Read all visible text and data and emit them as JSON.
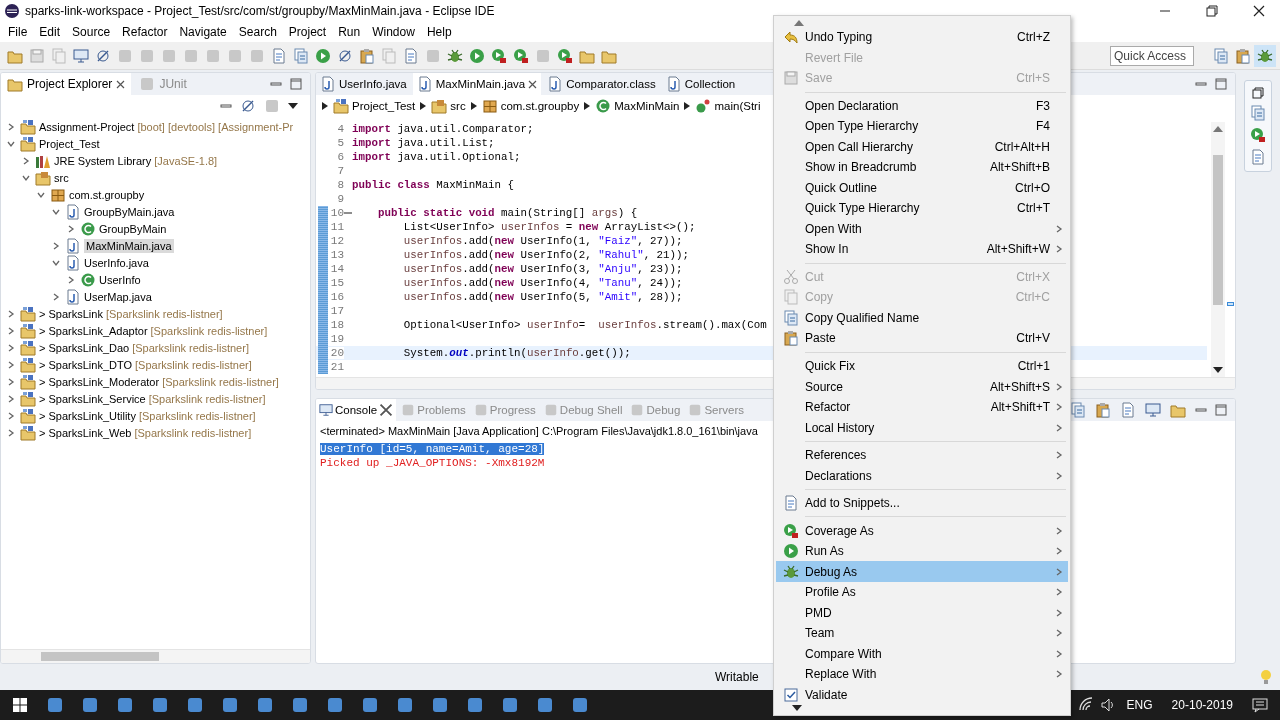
{
  "window": {
    "title": "sparks-link-workspace - Project_Test/src/com/st/groupby/MaxMinMain.java - Eclipse IDE"
  },
  "menu_bar": [
    "File",
    "Edit",
    "Source",
    "Refactor",
    "Navigate",
    "Search",
    "Project",
    "Run",
    "Window",
    "Help"
  ],
  "quick_access": {
    "placeholder": "Quick Access"
  },
  "project_explorer": {
    "tabs": [
      {
        "label": "Project Explorer",
        "selected": true
      },
      {
        "label": "JUnit",
        "selected": false
      }
    ],
    "tree": [
      {
        "label": "Assignment-Project",
        "decoration": "[boot] [devtools] [Assignment-Pr",
        "kind": "project",
        "expanded": false,
        "selected": false
      },
      {
        "label": "Project_Test",
        "kind": "project",
        "expanded": true,
        "selected": false,
        "children": [
          {
            "label": "JRE System Library",
            "decoration": "[JavaSE-1.8]",
            "kind": "library",
            "expanded": false,
            "selected": false
          },
          {
            "label": "src",
            "kind": "source-folder",
            "expanded": true,
            "selected": false,
            "children": [
              {
                "label": "com.st.groupby",
                "kind": "package",
                "expanded": true,
                "selected": false,
                "children": [
                  {
                    "label": "GroupByMain.java",
                    "kind": "java-file",
                    "expanded": true,
                    "selected": false,
                    "children": [
                      {
                        "label": "GroupByMain",
                        "kind": "class",
                        "expanded": false,
                        "selected": false
                      }
                    ]
                  },
                  {
                    "label": "MaxMinMain.java",
                    "kind": "java-file",
                    "expanded": false,
                    "selected": true
                  },
                  {
                    "label": "UserInfo.java",
                    "kind": "java-file",
                    "expanded": true,
                    "selected": false,
                    "children": [
                      {
                        "label": "UserInfo",
                        "kind": "class",
                        "expanded": false,
                        "selected": false
                      }
                    ]
                  },
                  {
                    "label": "UserMap.java",
                    "kind": "java-file",
                    "expanded": false,
                    "selected": false
                  }
                ]
              }
            ]
          }
        ]
      },
      {
        "label": "> SparksLink",
        "decoration": "[Sparkslink redis-listner]",
        "kind": "project",
        "expanded": false,
        "selected": false
      },
      {
        "label": "> SparksLink_Adaptor",
        "decoration": "[Sparkslink redis-listner]",
        "kind": "project",
        "expanded": false,
        "selected": false
      },
      {
        "label": "> SparksLink_Dao",
        "decoration": "[Sparkslink redis-listner]",
        "kind": "project",
        "expanded": false,
        "selected": false
      },
      {
        "label": "> SparksLink_DTO",
        "decoration": "[Sparkslink redis-listner]",
        "kind": "project",
        "expanded": false,
        "selected": false
      },
      {
        "label": "> SparksLink_Moderator",
        "decoration": "[Sparkslink redis-listner]",
        "kind": "project",
        "expanded": false,
        "selected": false
      },
      {
        "label": "> SparksLink_Service",
        "decoration": "[Sparkslink redis-listner]",
        "kind": "project",
        "expanded": false,
        "selected": false
      },
      {
        "label": "> SparksLink_Utility",
        "decoration": "[Sparkslink redis-listner]",
        "kind": "project",
        "expanded": false,
        "selected": false
      },
      {
        "label": "> SparksLink_Web",
        "decoration": "[Sparkslink redis-listner]",
        "kind": "project",
        "expanded": false,
        "selected": false
      }
    ]
  },
  "editor": {
    "tabs": [
      {
        "label": "UserInfo.java",
        "selected": false
      },
      {
        "label": "MaxMinMain.java",
        "selected": true
      },
      {
        "label": "Comparator.class",
        "selected": false
      },
      {
        "label": "Collection",
        "selected": false
      }
    ],
    "breadcrumb": [
      {
        "label": "Project_Test",
        "kind": "project"
      },
      {
        "label": "src",
        "kind": "source-folder"
      },
      {
        "label": "com.st.groupby",
        "kind": "package"
      },
      {
        "label": "MaxMinMain",
        "kind": "class"
      },
      {
        "label": "main(Stri",
        "kind": "method"
      }
    ],
    "lines": [
      {
        "number": "4",
        "changed": false,
        "current": false,
        "code": [
          {
            "text": "import",
            "kind": "keyword"
          },
          {
            "text": " java.util.Comparator;",
            "kind": "plain"
          }
        ]
      },
      {
        "number": "5",
        "changed": false,
        "current": false,
        "code": [
          {
            "text": "import",
            "kind": "keyword"
          },
          {
            "text": " java.util.List;",
            "kind": "plain"
          }
        ]
      },
      {
        "number": "6",
        "changed": false,
        "current": false,
        "code": [
          {
            "text": "import",
            "kind": "keyword"
          },
          {
            "text": " java.util.Optional;",
            "kind": "plain"
          }
        ]
      },
      {
        "number": "7",
        "changed": false,
        "current": false
      },
      {
        "number": "8",
        "changed": false,
        "current": false,
        "code": [
          {
            "text": "public",
            "kind": "keyword"
          },
          {
            "text": " class",
            "kind": "keyword"
          },
          {
            "text": " MaxMinMain {",
            "kind": "plain"
          }
        ]
      },
      {
        "number": "9",
        "changed": false,
        "current": false
      },
      {
        "number": "10",
        "changed": true,
        "current": false,
        "folding": true,
        "code": [
          {
            "text": "    public",
            "kind": "keyword"
          },
          {
            "text": " static",
            "kind": "keyword"
          },
          {
            "text": " void",
            "kind": "keyword"
          },
          {
            "text": " main(String[] ",
            "kind": "plain"
          },
          {
            "text": "args",
            "kind": "variable"
          },
          {
            "text": ") {",
            "kind": "plain"
          }
        ]
      },
      {
        "number": "11",
        "changed": true,
        "current": false,
        "code": [
          {
            "text": "        List<UserInfo> ",
            "kind": "plain"
          },
          {
            "text": "userInfos",
            "kind": "variable"
          },
          {
            "text": " = ",
            "kind": "plain"
          },
          {
            "text": "new",
            "kind": "keyword"
          },
          {
            "text": " ArrayList<>();",
            "kind": "plain"
          }
        ]
      },
      {
        "number": "12",
        "changed": true,
        "current": false,
        "code": [
          {
            "text": "        userInfos",
            "kind": "variable"
          },
          {
            "text": ".add(",
            "kind": "plain"
          },
          {
            "text": "new",
            "kind": "keyword"
          },
          {
            "text": " UserInfo(1, ",
            "kind": "plain"
          },
          {
            "text": "\"Faiz\"",
            "kind": "string"
          },
          {
            "text": ", 27));",
            "kind": "plain"
          }
        ]
      },
      {
        "number": "13",
        "changed": true,
        "current": false,
        "code": [
          {
            "text": "        userInfos",
            "kind": "variable"
          },
          {
            "text": ".add(",
            "kind": "plain"
          },
          {
            "text": "new",
            "kind": "keyword"
          },
          {
            "text": " UserInfo(2, ",
            "kind": "plain"
          },
          {
            "text": "\"Rahul\"",
            "kind": "string"
          },
          {
            "text": ", 21));",
            "kind": "plain"
          }
        ]
      },
      {
        "number": "14",
        "changed": true,
        "current": false,
        "code": [
          {
            "text": "        userInfos",
            "kind": "variable"
          },
          {
            "text": ".add(",
            "kind": "plain"
          },
          {
            "text": "new",
            "kind": "keyword"
          },
          {
            "text": " UserInfo(3, ",
            "kind": "plain"
          },
          {
            "text": "\"Anju\"",
            "kind": "string"
          },
          {
            "text": ", 23));",
            "kind": "plain"
          }
        ]
      },
      {
        "number": "15",
        "changed": true,
        "current": false,
        "code": [
          {
            "text": "        userInfos",
            "kind": "variable"
          },
          {
            "text": ".add(",
            "kind": "plain"
          },
          {
            "text": "new",
            "kind": "keyword"
          },
          {
            "text": " UserInfo(4, ",
            "kind": "plain"
          },
          {
            "text": "\"Tanu\"",
            "kind": "string"
          },
          {
            "text": ", 24));",
            "kind": "plain"
          }
        ]
      },
      {
        "number": "16",
        "changed": true,
        "current": false,
        "code": [
          {
            "text": "        userInfos",
            "kind": "variable"
          },
          {
            "text": ".add(",
            "kind": "plain"
          },
          {
            "text": "new",
            "kind": "keyword"
          },
          {
            "text": " UserInfo(5, ",
            "kind": "plain"
          },
          {
            "text": "\"Amit\"",
            "kind": "string"
          },
          {
            "text": ", 28));",
            "kind": "plain"
          }
        ]
      },
      {
        "number": "17",
        "changed": true,
        "current": false
      },
      {
        "number": "18",
        "changed": true,
        "current": false,
        "code": [
          {
            "text": "        Optional<UserInfo> ",
            "kind": "plain"
          },
          {
            "text": "userInfo",
            "kind": "variable"
          },
          {
            "text": "=  ",
            "kind": "plain"
          },
          {
            "text": "userInfos",
            "kind": "variable"
          },
          {
            "text": ".stream().max(Com",
            "kind": "plain"
          }
        ]
      },
      {
        "number": "19",
        "changed": true,
        "current": false
      },
      {
        "number": "20",
        "changed": true,
        "current": true,
        "code": [
          {
            "text": "        System.",
            "kind": "plain"
          },
          {
            "text": "out",
            "kind": "field"
          },
          {
            "text": ".println(",
            "kind": "plain"
          },
          {
            "text": "userInfo",
            "kind": "variable"
          },
          {
            "text": ".get());",
            "kind": "plain"
          }
        ]
      },
      {
        "number": "21",
        "changed": true,
        "current": false
      }
    ]
  },
  "console": {
    "tabs": [
      {
        "label": "Console",
        "selected": true
      },
      {
        "label": "Problems",
        "selected": false
      },
      {
        "label": "Progress",
        "selected": false
      },
      {
        "label": "Debug Shell",
        "selected": false
      },
      {
        "label": "Debug",
        "selected": false
      },
      {
        "label": "Servers",
        "selected": false
      }
    ],
    "header": "<terminated> MaxMinMain [Java Application] C:\\Program Files\\Java\\jdk1.8.0_161\\bin\\java",
    "output": [
      {
        "text": "UserInfo [id=5, name=Amit, age=28]",
        "kind": "stdout",
        "selected": true
      },
      {
        "text": "Picked up _JAVA_OPTIONS: -Xmx8192M",
        "kind": "stderr",
        "selected": false
      }
    ]
  },
  "status_bar": {
    "mode": "Writable"
  },
  "taskbar": {
    "language": "ENG",
    "date": "20-10-2019"
  },
  "context_menu": {
    "groups": [
      [
        {
          "label": "Undo Typing",
          "shortcut": "Ctrl+Z",
          "kind": "undo",
          "disabled": false,
          "submenu": false,
          "selected": false
        },
        {
          "label": "Revert File",
          "disabled": true,
          "submenu": false,
          "selected": false
        },
        {
          "label": "Save",
          "shortcut": "Ctrl+S",
          "kind": "save",
          "disabled": true,
          "submenu": false,
          "selected": false
        }
      ],
      [
        {
          "label": "Open Declaration",
          "shortcut": "F3",
          "disabled": false,
          "submenu": false,
          "selected": false
        },
        {
          "label": "Open Type Hierarchy",
          "shortcut": "F4",
          "disabled": false,
          "submenu": false,
          "selected": false
        },
        {
          "label": "Open Call Hierarchy",
          "shortcut": "Ctrl+Alt+H",
          "disabled": false,
          "submenu": false,
          "selected": false
        },
        {
          "label": "Show in Breadcrumb",
          "shortcut": "Alt+Shift+B",
          "disabled": false,
          "submenu": false,
          "selected": false
        },
        {
          "label": "Quick Outline",
          "shortcut": "Ctrl+O",
          "disabled": false,
          "submenu": false,
          "selected": false
        },
        {
          "label": "Quick Type Hierarchy",
          "shortcut": "Ctrl+T",
          "disabled": false,
          "submenu": false,
          "selected": false
        },
        {
          "label": "Open With",
          "disabled": false,
          "submenu": true,
          "selected": false
        },
        {
          "label": "Show In",
          "shortcut": "Alt+Shift+W",
          "disabled": false,
          "submenu": true,
          "selected": false
        }
      ],
      [
        {
          "label": "Cut",
          "shortcut": "Ctrl+X",
          "kind": "cut",
          "disabled": true,
          "submenu": false,
          "selected": false
        },
        {
          "label": "Copy",
          "shortcut": "Ctrl+C",
          "kind": "copy",
          "disabled": true,
          "submenu": false,
          "selected": false
        },
        {
          "label": "Copy Qualified Name",
          "kind": "copy-name",
          "disabled": false,
          "submenu": false,
          "selected": false
        },
        {
          "label": "Paste",
          "shortcut": "Ctrl+V",
          "kind": "paste",
          "disabled": false,
          "submenu": false,
          "selected": false
        }
      ],
      [
        {
          "label": "Quick Fix",
          "shortcut": "Ctrl+1",
          "disabled": false,
          "submenu": false,
          "selected": false
        },
        {
          "label": "Source",
          "shortcut": "Alt+Shift+S",
          "disabled": false,
          "submenu": true,
          "selected": false
        },
        {
          "label": "Refactor",
          "shortcut": "Alt+Shift+T",
          "disabled": false,
          "submenu": true,
          "selected": false
        },
        {
          "label": "Local History",
          "disabled": false,
          "submenu": true,
          "selected": false
        }
      ],
      [
        {
          "label": "References",
          "disabled": false,
          "submenu": true,
          "selected": false
        },
        {
          "label": "Declarations",
          "disabled": false,
          "submenu": true,
          "selected": false
        }
      ],
      [
        {
          "label": "Add to Snippets...",
          "kind": "snippet",
          "disabled": false,
          "submenu": false,
          "selected": false
        }
      ],
      [
        {
          "label": "Coverage As",
          "kind": "coverage",
          "disabled": false,
          "submenu": true,
          "selected": false
        },
        {
          "label": "Run As",
          "kind": "run",
          "disabled": false,
          "submenu": true,
          "selected": false
        },
        {
          "label": "Debug As",
          "kind": "debug",
          "disabled": false,
          "submenu": true,
          "selected": true
        },
        {
          "label": "Profile As",
          "disabled": false,
          "submenu": true,
          "selected": false
        },
        {
          "label": "PMD",
          "disabled": false,
          "submenu": true,
          "selected": false
        },
        {
          "label": "Team",
          "disabled": false,
          "submenu": true,
          "selected": false
        },
        {
          "label": "Compare With",
          "disabled": false,
          "submenu": true,
          "selected": false
        },
        {
          "label": "Replace With",
          "disabled": false,
          "submenu": true,
          "selected": false
        },
        {
          "label": "Validate",
          "kind": "check",
          "checked": true,
          "disabled": false,
          "submenu": false,
          "selected": false
        }
      ]
    ]
  }
}
